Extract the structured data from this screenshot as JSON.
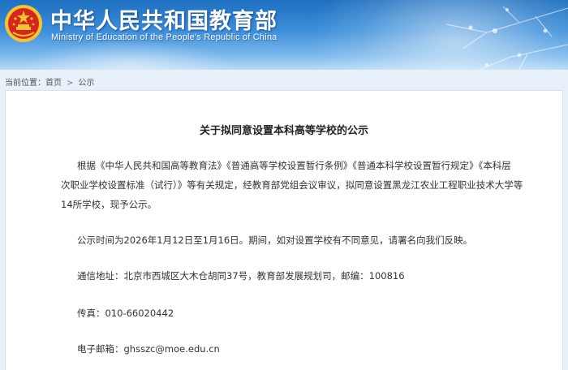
{
  "header": {
    "title": "中华人民共和国教育部",
    "subtitle": "Ministry of Education of the People's Republic of China"
  },
  "breadcrumb": {
    "label": "当前位置：",
    "home": "首页",
    "separator": ">",
    "current": "公示"
  },
  "article": {
    "title": "关于拟同意设置本科高等学校的公示",
    "paragraph1_lines": [
      "根据《中华人民共和国高等教育法》《普通高等学校设置暂行条例》《普通本科学校设置暂行规定》《本科层",
      "次职业学校设置标准（试行）》等有关规定，经教育部党组会议审议，拟同意设置黑龙江农业工程职业技术大学等",
      "14所学校，现予公示。"
    ],
    "paragraph2": "公示时间为2026年1月12日至1月16日。期间，如对设置学校有不同意见，请署名向我们反映。",
    "address": "通信地址：北京市西城区大木仓胡同37号，教育部发展规划司，邮编：100816",
    "fax": "传真：010-66020442",
    "email": "电子邮箱：ghsszc@moe.edu.cn"
  },
  "colors": {
    "banner_top": "#1e6fc0",
    "banner_bottom": "#b9dbf6",
    "page_background": "#e8f1f9",
    "emblem_red": "#d7261e",
    "emblem_gold": "#f4c430"
  },
  "icons": {
    "emblem": "national-emblem-icon",
    "breadcrumb_separator": "chevron-right-icon"
  }
}
